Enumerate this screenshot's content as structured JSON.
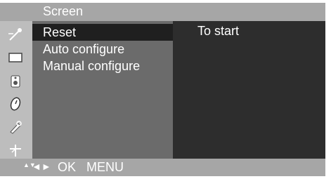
{
  "menu": {
    "title": "Screen",
    "icons": [
      {
        "name": "picture-icon",
        "selected": true
      },
      {
        "name": "screen-icon",
        "selected": false
      },
      {
        "name": "audio-icon",
        "selected": false
      },
      {
        "name": "time-icon",
        "selected": false
      },
      {
        "name": "option-icon",
        "selected": false
      },
      {
        "name": "input-icon",
        "selected": false
      }
    ],
    "items": [
      {
        "label": "Reset"
      },
      {
        "label": "Auto configure"
      },
      {
        "label": "Manual configure"
      }
    ],
    "detail_text": "To start"
  },
  "footer": {
    "updown_symbol": "▲▼",
    "leftright_symbol": "◄►",
    "ok_label": "OK",
    "menu_label": "MENU"
  },
  "colors": {
    "title_bar": "#a6a6a6",
    "icon_column": "#bdbdbd",
    "submenu_bg": "#6b6b6b",
    "selected_row": "#1f1f1f",
    "detail_bg": "#2d2d2d"
  }
}
